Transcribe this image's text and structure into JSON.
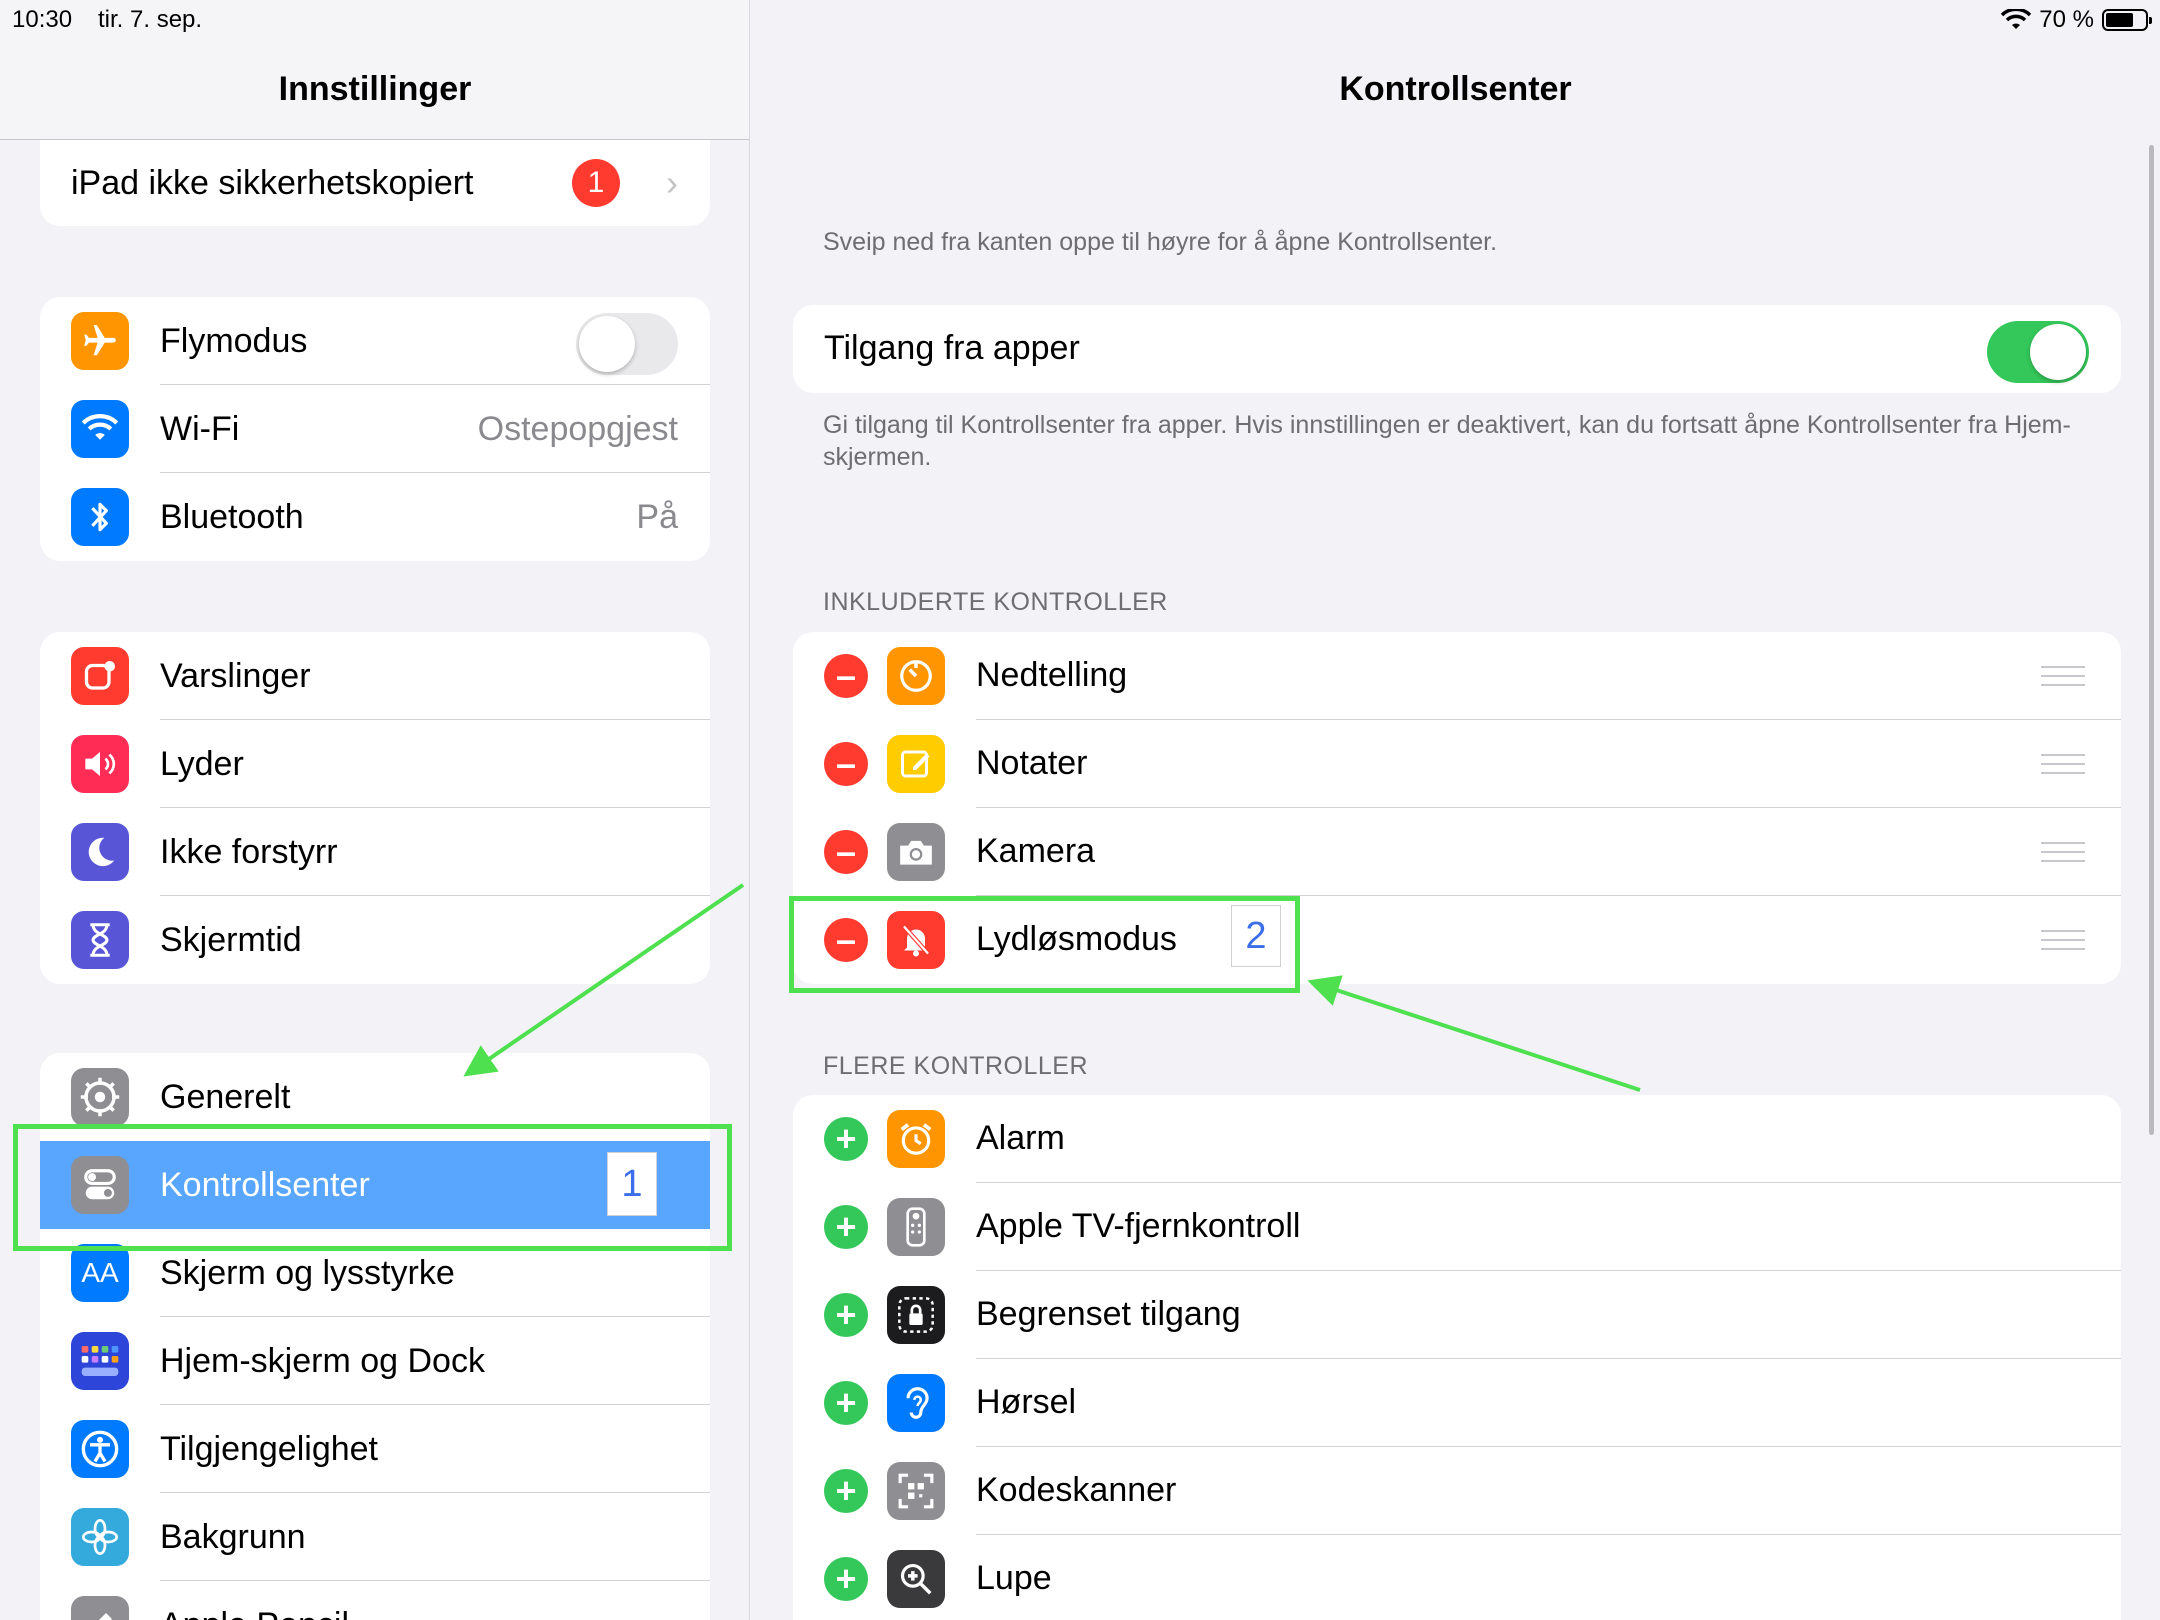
{
  "status_bar": {
    "time": "10:30",
    "date": "tir. 7. sep.",
    "battery": "70 %"
  },
  "sidebar": {
    "title": "Innstillinger",
    "backup": {
      "label": "iPad ikke sikkerhetskopiert",
      "badge": "1"
    },
    "connectivity": [
      {
        "label": "Flymodus",
        "toggle": false
      },
      {
        "label": "Wi-Fi",
        "value": "Ostepopgjest"
      },
      {
        "label": "Bluetooth",
        "value": "På"
      }
    ],
    "notifications_group": [
      {
        "label": "Varslinger"
      },
      {
        "label": "Lyder"
      },
      {
        "label": "Ikke forstyrr"
      },
      {
        "label": "Skjermtid"
      }
    ],
    "general_group": [
      {
        "label": "Generelt"
      },
      {
        "label": "Kontrollsenter"
      },
      {
        "label": "Skjerm og lysstyrke"
      },
      {
        "label": "Hjem-skjerm og Dock"
      },
      {
        "label": "Tilgjengelighet"
      },
      {
        "label": "Bakgrunn"
      },
      {
        "label": "Apple Pencil"
      }
    ]
  },
  "main": {
    "title": "Kontrollsenter",
    "swipe_hint": "Sveip ned fra kanten oppe til høyre for å åpne Kontrollsenter.",
    "access_label": "Tilgang fra apper",
    "access_toggle": true,
    "access_hint": "Gi tilgang til Kontrollsenter fra apper. Hvis innstillingen er deaktivert, kan du fortsatt åpne Kontrollsenter fra Hjem-skjermen.",
    "included_header": "INKLUDERTE KONTROLLER",
    "included": [
      {
        "label": "Nedtelling"
      },
      {
        "label": "Notater"
      },
      {
        "label": "Kamera"
      },
      {
        "label": "Lydløsmodus"
      }
    ],
    "more_header": "FLERE KONTROLLER",
    "more": [
      {
        "label": "Alarm"
      },
      {
        "label": "Apple TV-fjernkontroll"
      },
      {
        "label": "Begrenset tilgang"
      },
      {
        "label": "Hørsel"
      },
      {
        "label": "Kodeskanner"
      },
      {
        "label": "Lupe"
      }
    ]
  },
  "annotations": {
    "step1": "1",
    "step2": "2"
  },
  "colors": {
    "accent": "#58a6ff",
    "highlight": "#4ee04e",
    "switch_on": "#34c759",
    "remove": "#ff3b30"
  }
}
